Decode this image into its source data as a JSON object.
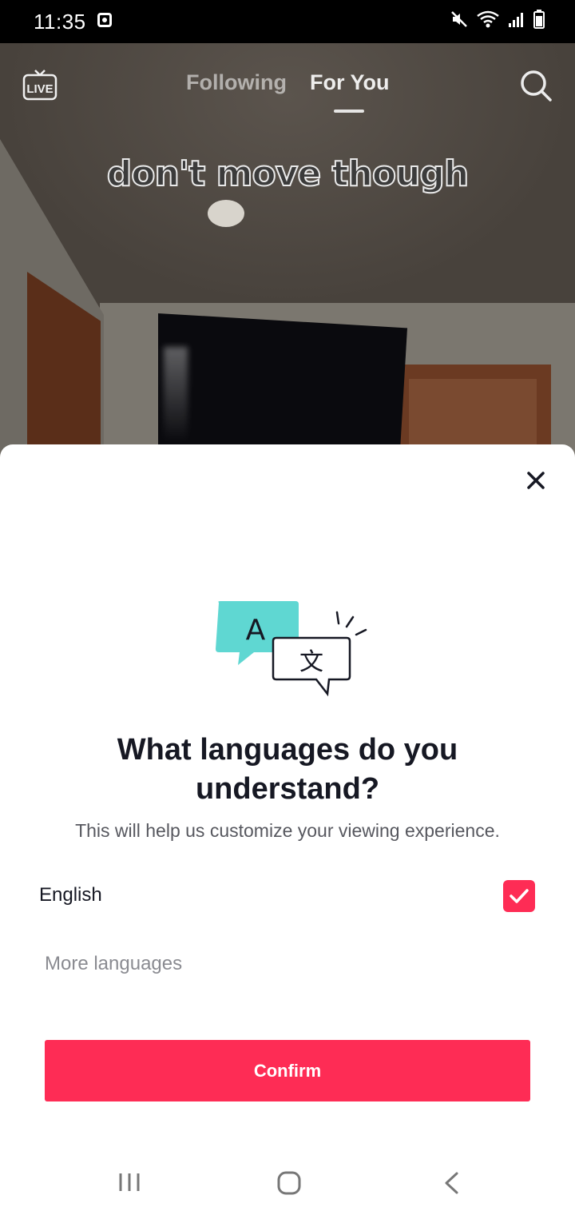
{
  "status_bar": {
    "time": "11:35"
  },
  "top_nav": {
    "live_label": "LIVE",
    "tabs": [
      {
        "label": "Following",
        "active": false
      },
      {
        "label": "For You",
        "active": true
      }
    ]
  },
  "video": {
    "caption": "don't move though"
  },
  "language_sheet": {
    "illustration": {
      "bubble_letter": "A",
      "bubble_glyph": "文"
    },
    "title": "What languages do you understand?",
    "subtitle": "This will help us customize your viewing experience.",
    "languages": [
      {
        "label": "English",
        "checked": true
      }
    ],
    "more_languages_label": "More languages",
    "confirm_label": "Confirm"
  },
  "colors": {
    "accent": "#fe2c55",
    "title_text": "#161823",
    "secondary_text": "#57585f",
    "muted_text": "#8a8b91",
    "illustration_bubble": "#5fd7d2"
  },
  "icons": [
    "notification-icon",
    "mute-icon",
    "wifi-icon",
    "signal-icon",
    "battery-icon",
    "live-icon",
    "search-icon",
    "close-icon",
    "translate-illustration",
    "check-icon",
    "recent-apps-icon",
    "home-icon",
    "back-icon"
  ]
}
